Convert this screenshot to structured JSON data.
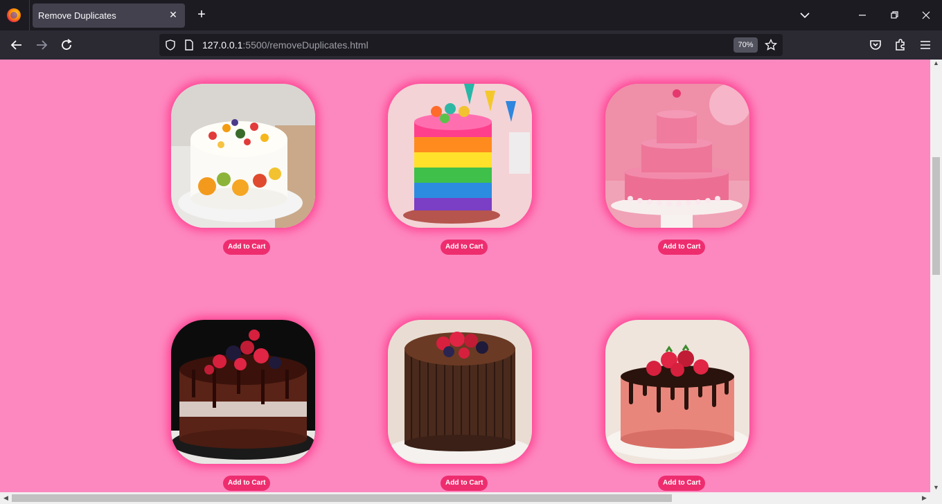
{
  "browser": {
    "tab_title": "Remove Duplicates",
    "url_host": "127.0.0.1",
    "url_path": ":5500/removeDuplicates.html",
    "zoom": "70%"
  },
  "page": {
    "background": "#fd88bf",
    "button_color": "#ee2d6f",
    "cards": [
      {
        "image": "fruit cream cake",
        "button": "Add to Cart"
      },
      {
        "image": "rainbow layer cake",
        "button": "Add to Cart"
      },
      {
        "image": "pink tiered cake",
        "button": "Add to Cart"
      },
      {
        "image": "chocolate berry layer cake",
        "button": "Add to Cart"
      },
      {
        "image": "chocolate curl berry cake",
        "button": "Add to Cart"
      },
      {
        "image": "strawberry drip cake",
        "button": "Add to Cart"
      }
    ]
  }
}
